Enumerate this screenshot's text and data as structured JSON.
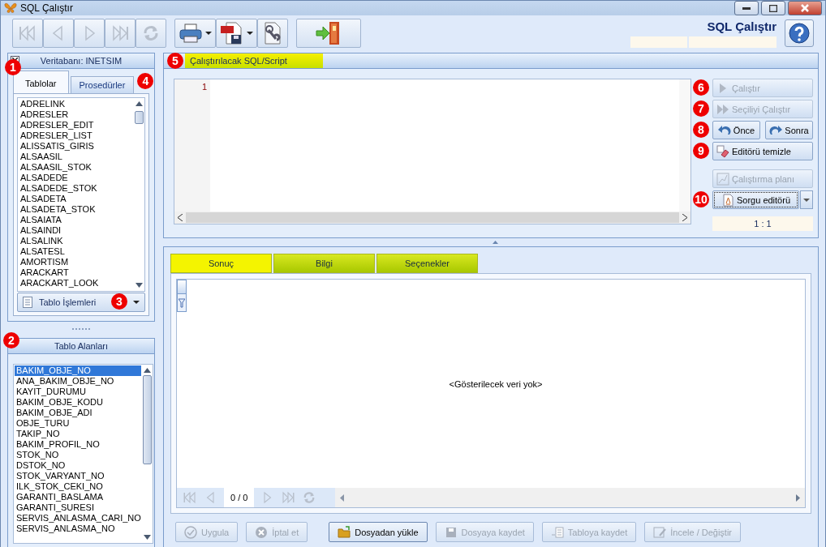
{
  "window": {
    "title": "SQL Çalıştır"
  },
  "toolbar": [
    {
      "disabled": true
    },
    {
      "disabled": true
    },
    {
      "disabled": true
    },
    {
      "disabled": true
    },
    {
      "disabled": true
    },
    {
      "disabled": false
    },
    {
      "disabled": false
    },
    {
      "disabled": false
    },
    {
      "disabled": false
    }
  ],
  "header": {
    "title": "SQL Çalıştır"
  },
  "database_panel": {
    "title": "Veritabanı: INETSIM",
    "tabs": [
      {
        "label": "Tablolar",
        "selected": true,
        "badge": "1"
      },
      {
        "label": "Prosedürler",
        "selected": false,
        "badge": "4"
      }
    ],
    "tables": [
      "ADRELINK",
      "ADRESLER",
      "ADRESLER_EDIT",
      "ADRESLER_LIST",
      "ALISSATIS_GIRIS",
      "ALSAASIL",
      "ALSAASIL_STOK",
      "ALSADEDE",
      "ALSADEDE_STOK",
      "ALSADETA",
      "ALSADETA_STOK",
      "ALSAIATA",
      "ALSAINDI",
      "ALSALINK",
      "ALSATESL",
      "AMORTISM",
      "ARACKART",
      "ARACKART_LOOK"
    ],
    "action_button": {
      "label": "Tablo İşlemleri",
      "badge": "3"
    }
  },
  "fields_panel": {
    "title": "Tablo Alanları",
    "badge": "2",
    "fields": [
      {
        "name": "BAKIM_OBJE_NO",
        "selected": true
      },
      {
        "name": "ANA_BAKIM_OBJE_NO",
        "selected": false
      },
      {
        "name": "KAYIT_DURUMU",
        "selected": false
      },
      {
        "name": "BAKIM_OBJE_KODU",
        "selected": false
      },
      {
        "name": "BAKIM_OBJE_ADI",
        "selected": false
      },
      {
        "name": "OBJE_TURU",
        "selected": false
      },
      {
        "name": "TAKIP_NO",
        "selected": false
      },
      {
        "name": "BAKIM_PROFIL_NO",
        "selected": false
      },
      {
        "name": "STOK_NO",
        "selected": false
      },
      {
        "name": "DSTOK_NO",
        "selected": false
      },
      {
        "name": "STOK_VARYANT_NO",
        "selected": false
      },
      {
        "name": "ILK_STOK_CEKI_NO",
        "selected": false
      },
      {
        "name": "GARANTI_BASLAMA",
        "selected": false
      },
      {
        "name": "GARANTI_SURESI",
        "selected": false
      },
      {
        "name": "SERVIS_ANLASMA_CARI_NO",
        "selected": false
      },
      {
        "name": "SERVIS_ANLASMA_NO",
        "selected": false
      }
    ]
  },
  "script_panel": {
    "title": "Çalıştırılacak SQL/Script",
    "badge": "5",
    "line_numbers": [
      "1"
    ],
    "actions": [
      {
        "kind": "single",
        "label": "Çalıştır",
        "disabled": true,
        "badge": "6"
      },
      {
        "kind": "single",
        "label": "Seçiliyi Çalıştır",
        "disabled": true,
        "badge": "7"
      },
      {
        "kind": "pair",
        "badge": "8",
        "buttons": [
          {
            "label": "Önce",
            "disabled": false
          },
          {
            "label": "Sonra",
            "disabled": false
          }
        ]
      },
      {
        "kind": "single",
        "label": "Editörü temizle",
        "disabled": false,
        "badge": "9"
      },
      {
        "kind": "single",
        "label": "Çalıştırma planı",
        "disabled": true
      },
      {
        "kind": "split",
        "label": "Sorgu editörü",
        "disabled": false,
        "badge": "10"
      }
    ],
    "position": "1 : 1"
  },
  "result_tabs": [
    {
      "label": "Sonuç",
      "selected": true
    },
    {
      "label": "Bilgi",
      "selected": false
    },
    {
      "label": "Seçenekler",
      "selected": false
    }
  ],
  "empty_message": "<Gösterilecek veri yok>",
  "pager": "0 / 0",
  "bottom_buttons": [
    {
      "label": "Uygula",
      "disabled": true
    },
    {
      "label": "İptal et",
      "disabled": true
    },
    {
      "label": "Dosyadan yükle",
      "disabled": false
    },
    {
      "label": "Dosyaya kaydet",
      "disabled": true
    },
    {
      "label": "Tabloya kaydet",
      "disabled": true
    },
    {
      "label": "İncele / Değiştir",
      "disabled": true
    }
  ]
}
